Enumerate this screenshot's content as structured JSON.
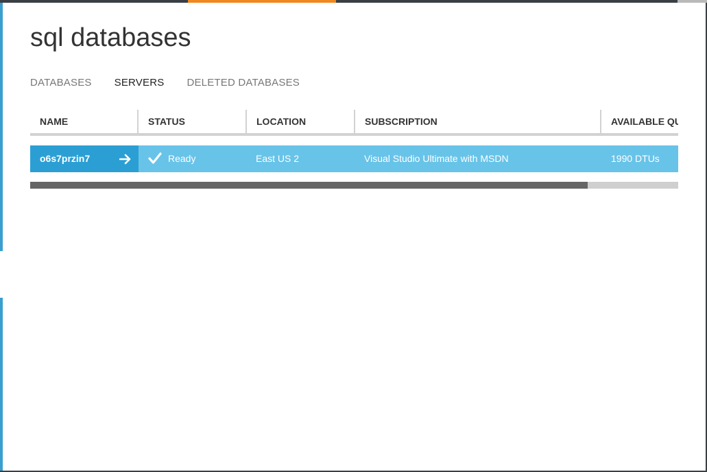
{
  "page": {
    "title": "sql databases"
  },
  "tabs": [
    {
      "label": "DATABASES",
      "active": false
    },
    {
      "label": "SERVERS",
      "active": true
    },
    {
      "label": "DELETED DATABASES",
      "active": false
    }
  ],
  "columns": [
    "NAME",
    "STATUS",
    "LOCATION",
    "SUBSCRIPTION",
    "AVAILABLE QU"
  ],
  "rows": [
    {
      "name": "o6s7przin7",
      "status": "Ready",
      "location": "East US 2",
      "subscription": "Visual Studio Ultimate with MSDN",
      "available_quota": "1990 DTUs"
    }
  ],
  "icons": {
    "row_action": "arrow-right-icon",
    "status": "checkmark-icon"
  },
  "colors": {
    "accent": "#f0871f",
    "row_selected": "#68c3e8",
    "row_name": "#2b9fd4",
    "edge": "#3a9fcf"
  },
  "scroll": {
    "horizontal_visible_fraction": 0.86
  }
}
